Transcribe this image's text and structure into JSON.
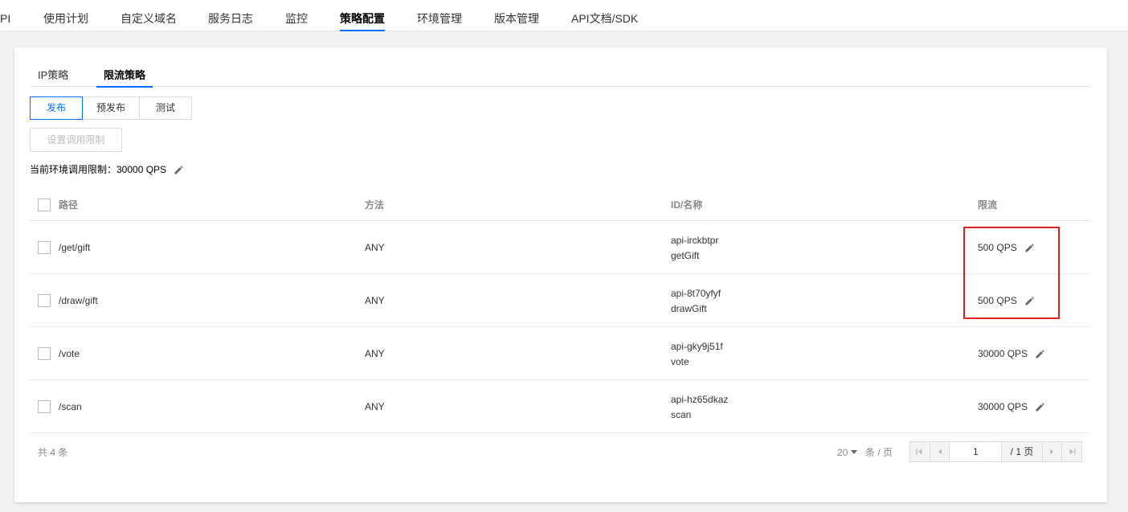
{
  "topnav": {
    "tabs": [
      {
        "label": "PI",
        "active": false
      },
      {
        "label": "使用计划",
        "active": false
      },
      {
        "label": "自定义域名",
        "active": false
      },
      {
        "label": "服务日志",
        "active": false
      },
      {
        "label": "监控",
        "active": false
      },
      {
        "label": "策略配置",
        "active": true
      },
      {
        "label": "环境管理",
        "active": false
      },
      {
        "label": "版本管理",
        "active": false
      },
      {
        "label": "API文档/SDK",
        "active": false
      }
    ]
  },
  "subtabs": [
    {
      "label": "IP策略",
      "active": false
    },
    {
      "label": "限流策略",
      "active": true
    }
  ],
  "env_segments": [
    {
      "label": "发布",
      "active": true
    },
    {
      "label": "预发布",
      "active": false
    },
    {
      "label": "测试",
      "active": false
    }
  ],
  "limit_button_label": "设置调用限制",
  "env_limit_text": "当前环境调用限制：30000 QPS",
  "table": {
    "headers": {
      "path": "路径",
      "method": "方法",
      "id_name": "ID/名称",
      "rate_limit": "限流"
    },
    "rows": [
      {
        "path": "/get/gift",
        "method": "ANY",
        "api_id": "api-irckbtpr",
        "api_name": "getGift",
        "qps": "500 QPS"
      },
      {
        "path": "/draw/gift",
        "method": "ANY",
        "api_id": "api-8t70yfyf",
        "api_name": "drawGift",
        "qps": "500 QPS"
      },
      {
        "path": "/vote",
        "method": "ANY",
        "api_id": "api-gky9j51f",
        "api_name": "vote",
        "qps": "30000 QPS"
      },
      {
        "path": "/scan",
        "method": "ANY",
        "api_id": "api-hz65dkaz",
        "api_name": "scan",
        "qps": "30000 QPS"
      }
    ]
  },
  "footer": {
    "total_text": "共 4 条",
    "page_size": "20",
    "per_page_text": "条 / 页",
    "current_page": "1",
    "total_pages_text": "/ 1 页"
  },
  "colors": {
    "accent": "#006eff",
    "highlight": "#e02020"
  },
  "icons": {
    "edit": "pencil-icon",
    "first": "first-page-icon",
    "prev": "prev-page-icon",
    "next": "next-page-icon",
    "last": "last-page-icon"
  }
}
